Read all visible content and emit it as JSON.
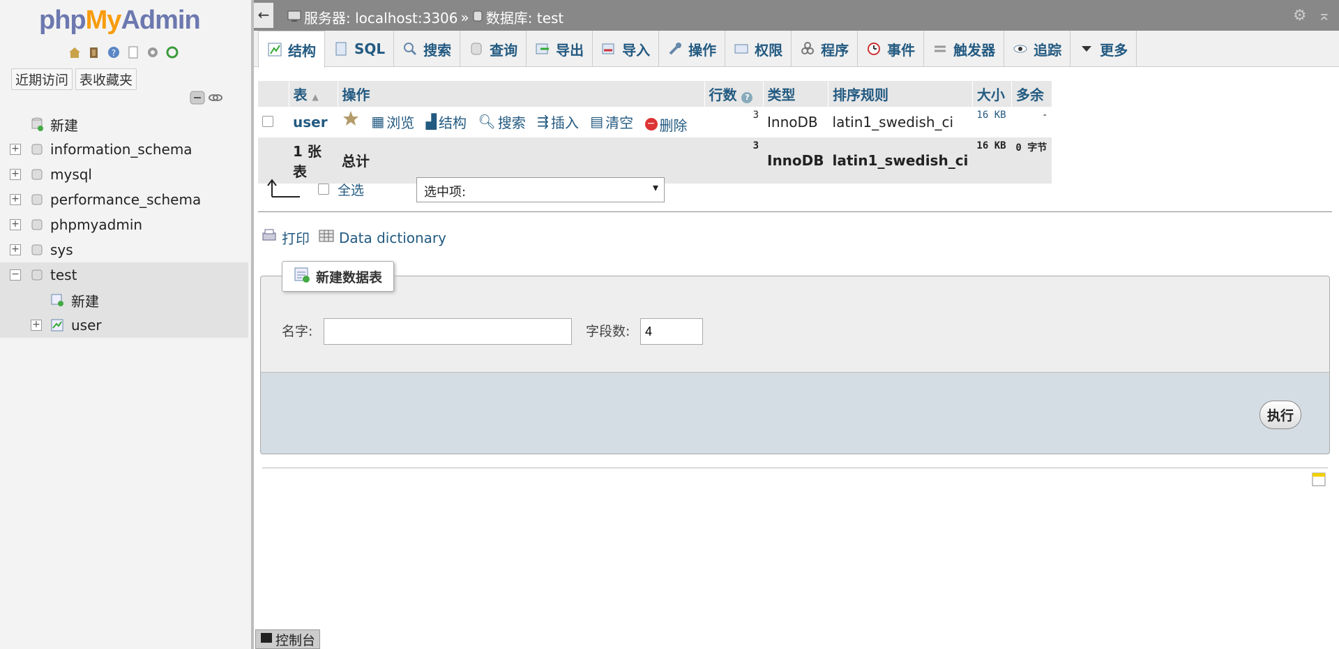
{
  "logo": {
    "php": "php",
    "my": "My",
    "admin": "Admin"
  },
  "left": {
    "recent": "近期访问",
    "favorites": "表收藏夹",
    "tree": [
      {
        "label": "新建"
      },
      {
        "label": "information_schema"
      },
      {
        "label": "mysql"
      },
      {
        "label": "performance_schema"
      },
      {
        "label": "phpmyadmin"
      },
      {
        "label": "sys"
      },
      {
        "label": "test"
      }
    ],
    "test_children": [
      {
        "label": "新建"
      },
      {
        "label": "user"
      }
    ]
  },
  "topbar": {
    "server": "服务器: localhost:3306",
    "sep": "»",
    "database": "数据库: test"
  },
  "tabs": [
    {
      "label": "结构",
      "icon": "structure-icon"
    },
    {
      "label": "SQL",
      "icon": "sql-icon"
    },
    {
      "label": "搜索",
      "icon": "search-icon"
    },
    {
      "label": "查询",
      "icon": "query-icon"
    },
    {
      "label": "导出",
      "icon": "export-icon"
    },
    {
      "label": "导入",
      "icon": "import-icon"
    },
    {
      "label": "操作",
      "icon": "wrench-icon"
    },
    {
      "label": "权限",
      "icon": "privileges-icon"
    },
    {
      "label": "程序",
      "icon": "routines-icon"
    },
    {
      "label": "事件",
      "icon": "events-icon"
    },
    {
      "label": "触发器",
      "icon": "triggers-icon"
    },
    {
      "label": "追踪",
      "icon": "tracking-icon"
    },
    {
      "label": "更多",
      "icon": "more-icon"
    }
  ],
  "table": {
    "headers": {
      "table": "表",
      "action": "操作",
      "rows": "行数",
      "type": "类型",
      "collation": "排序规则",
      "size": "大小",
      "overhead": "多余"
    },
    "row": {
      "name": "user",
      "browse": "浏览",
      "structure": "结构",
      "search": "搜索",
      "insert": "插入",
      "empty": "清空",
      "drop": "删除",
      "rows": "3",
      "type": "InnoDB",
      "collation": "latin1_swedish_ci",
      "size": "16 KB",
      "overhead": "-"
    },
    "footer": {
      "count": "1 张表",
      "total": "总计",
      "rows": "3",
      "type": "InnoDB",
      "collation": "latin1_swedish_ci",
      "size": "16 KB",
      "overhead": "0 字节"
    }
  },
  "withsel": {
    "checkall": "全选",
    "select": "选中项:"
  },
  "print": {
    "print": "打印",
    "dict": "Data dictionary"
  },
  "create": {
    "legend": "新建数据表",
    "name_label": "名字:",
    "name_value": "",
    "cols_label": "字段数:",
    "cols_value": "4",
    "go": "执行"
  },
  "console": "控制台"
}
